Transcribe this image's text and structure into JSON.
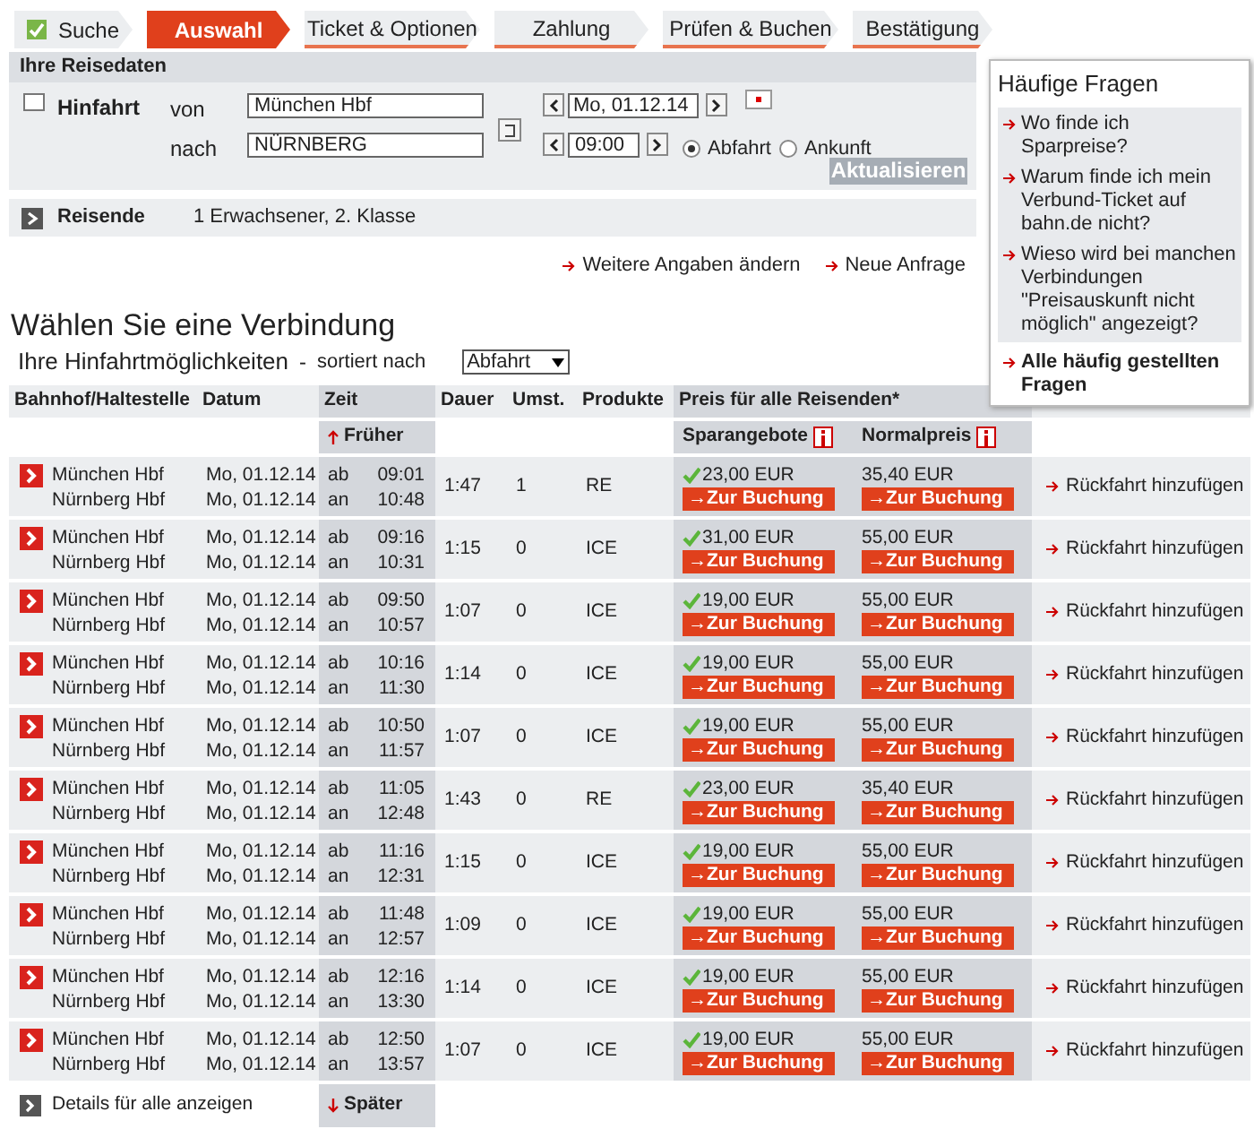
{
  "steps": [
    {
      "label": "Suche",
      "done": true,
      "selected": false
    },
    {
      "label": "Auswahl",
      "done": false,
      "selected": true
    },
    {
      "label": "Ticket & Optionen",
      "done": false,
      "selected": false
    },
    {
      "label": "Zahlung",
      "done": false,
      "selected": false
    },
    {
      "label": "Prüfen & Buchen",
      "done": false,
      "selected": false
    },
    {
      "label": "Bestätigung",
      "done": false,
      "selected": false
    }
  ],
  "travel_data": {
    "title": "Ihre Reisedaten",
    "direction": "Hinfahrt",
    "from_label": "von",
    "from": "München Hbf",
    "to_label": "nach",
    "to": "NÜRNBERG",
    "date": "Mo, 01.12.14",
    "time": "09:00",
    "modes": [
      {
        "label": "Abfahrt",
        "selected": true
      },
      {
        "label": "Ankunft",
        "selected": false
      }
    ],
    "update_button": "Aktualisieren",
    "travellers_label": "Reisende",
    "travellers": "1 Erwachsener, 2. Klasse",
    "links": [
      "Weitere Angaben ändern",
      "Neue Anfrage"
    ]
  },
  "faq": {
    "title": "Häufige Fragen",
    "items": [
      {
        "text": "Wo finde ich Sparpreise?",
        "kind": "question"
      },
      {
        "text": "Warum finde ich mein Verbund-Ticket auf bahn.de nicht?",
        "kind": "question"
      },
      {
        "text": "Wieso wird bei manchen Verbindungen \"Preisauskunft nicht möglich\" angezeigt?",
        "kind": "question"
      },
      {
        "text": "Alle häufig gestellten Fragen",
        "kind": "all"
      }
    ]
  },
  "heading": "Wählen Sie eine Verbindung",
  "subheading": "Ihre Hinfahrtmöglichkeiten",
  "dash": "-",
  "sort_label": "sortiert nach",
  "sort_value": "Abfahrt",
  "table": {
    "columns": [
      "Bahnhof/Haltestelle",
      "Datum",
      "Zeit",
      "Dauer",
      "Umst.",
      "Produkte",
      "Preis für alle Reisenden*"
    ],
    "earlier": "Früher",
    "later": "Später",
    "price_columns": [
      "Sparangebote",
      "Normalpreis"
    ],
    "details_label": "Details für alle anzeigen",
    "rows": [
      {
        "from": "München Hbf",
        "to": "Nürnberg Hbf",
        "dep_date": "Mo, 01.12.14",
        "arr_date": "Mo, 01.12.14",
        "dep_label": "ab",
        "dep": "09:01",
        "arr_label": "an",
        "arr": "10:48",
        "duration": "1:47",
        "changes": "1",
        "products": "RE",
        "saver": "23,00 EUR",
        "saver_button": "→Zur Buchung",
        "normal": "35,40 EUR",
        "normal_button": "→Zur Buchung",
        "return_link": "Rückfahrt hinzufügen"
      },
      {
        "from": "München Hbf",
        "to": "Nürnberg Hbf",
        "dep_date": "Mo, 01.12.14",
        "arr_date": "Mo, 01.12.14",
        "dep_label": "ab",
        "dep": "09:16",
        "arr_label": "an",
        "arr": "10:31",
        "duration": "1:15",
        "changes": "0",
        "products": "ICE",
        "saver": "31,00 EUR",
        "saver_button": "→Zur Buchung",
        "normal": "55,00 EUR",
        "normal_button": "→Zur Buchung",
        "return_link": "Rückfahrt hinzufügen"
      },
      {
        "from": "München Hbf",
        "to": "Nürnberg Hbf",
        "dep_date": "Mo, 01.12.14",
        "arr_date": "Mo, 01.12.14",
        "dep_label": "ab",
        "dep": "09:50",
        "arr_label": "an",
        "arr": "10:57",
        "duration": "1:07",
        "changes": "0",
        "products": "ICE",
        "saver": "19,00 EUR",
        "saver_button": "→Zur Buchung",
        "normal": "55,00 EUR",
        "normal_button": "→Zur Buchung",
        "return_link": "Rückfahrt hinzufügen"
      },
      {
        "from": "München Hbf",
        "to": "Nürnberg Hbf",
        "dep_date": "Mo, 01.12.14",
        "arr_date": "Mo, 01.12.14",
        "dep_label": "ab",
        "dep": "10:16",
        "arr_label": "an",
        "arr": "11:30",
        "duration": "1:14",
        "changes": "0",
        "products": "ICE",
        "saver": "19,00 EUR",
        "saver_button": "→Zur Buchung",
        "normal": "55,00 EUR",
        "normal_button": "→Zur Buchung",
        "return_link": "Rückfahrt hinzufügen"
      },
      {
        "from": "München Hbf",
        "to": "Nürnberg Hbf",
        "dep_date": "Mo, 01.12.14",
        "arr_date": "Mo, 01.12.14",
        "dep_label": "ab",
        "dep": "10:50",
        "arr_label": "an",
        "arr": "11:57",
        "duration": "1:07",
        "changes": "0",
        "products": "ICE",
        "saver": "19,00 EUR",
        "saver_button": "→Zur Buchung",
        "normal": "55,00 EUR",
        "normal_button": "→Zur Buchung",
        "return_link": "Rückfahrt hinzufügen"
      },
      {
        "from": "München Hbf",
        "to": "Nürnberg Hbf",
        "dep_date": "Mo, 01.12.14",
        "arr_date": "Mo, 01.12.14",
        "dep_label": "ab",
        "dep": "11:05",
        "arr_label": "an",
        "arr": "12:48",
        "duration": "1:43",
        "changes": "0",
        "products": "RE",
        "saver": "23,00 EUR",
        "saver_button": "→Zur Buchung",
        "normal": "35,40 EUR",
        "normal_button": "→Zur Buchung",
        "return_link": "Rückfahrt hinzufügen"
      },
      {
        "from": "München Hbf",
        "to": "Nürnberg Hbf",
        "dep_date": "Mo, 01.12.14",
        "arr_date": "Mo, 01.12.14",
        "dep_label": "ab",
        "dep": "11:16",
        "arr_label": "an",
        "arr": "12:31",
        "duration": "1:15",
        "changes": "0",
        "products": "ICE",
        "saver": "19,00 EUR",
        "saver_button": "→Zur Buchung",
        "normal": "55,00 EUR",
        "normal_button": "→Zur Buchung",
        "return_link": "Rückfahrt hinzufügen"
      },
      {
        "from": "München Hbf",
        "to": "Nürnberg Hbf",
        "dep_date": "Mo, 01.12.14",
        "arr_date": "Mo, 01.12.14",
        "dep_label": "ab",
        "dep": "11:48",
        "arr_label": "an",
        "arr": "12:57",
        "duration": "1:09",
        "changes": "0",
        "products": "ICE",
        "saver": "19,00 EUR",
        "saver_button": "→Zur Buchung",
        "normal": "55,00 EUR",
        "normal_button": "→Zur Buchung",
        "return_link": "Rückfahrt hinzufügen"
      },
      {
        "from": "München Hbf",
        "to": "Nürnberg Hbf",
        "dep_date": "Mo, 01.12.14",
        "arr_date": "Mo, 01.12.14",
        "dep_label": "ab",
        "dep": "12:16",
        "arr_label": "an",
        "arr": "13:30",
        "duration": "1:14",
        "changes": "0",
        "products": "ICE",
        "saver": "19,00 EUR",
        "saver_button": "→Zur Buchung",
        "normal": "55,00 EUR",
        "normal_button": "→Zur Buchung",
        "return_link": "Rückfahrt hinzufügen"
      },
      {
        "from": "München Hbf",
        "to": "Nürnberg Hbf",
        "dep_date": "Mo, 01.12.14",
        "arr_date": "Mo, 01.12.14",
        "dep_label": "ab",
        "dep": "12:50",
        "arr_label": "an",
        "arr": "13:57",
        "duration": "1:07",
        "changes": "0",
        "products": "ICE",
        "saver": "19,00 EUR",
        "saver_button": "→Zur Buchung",
        "normal": "55,00 EUR",
        "normal_button": "→Zur Buchung",
        "return_link": "Rückfahrt hinzufügen"
      }
    ]
  }
}
